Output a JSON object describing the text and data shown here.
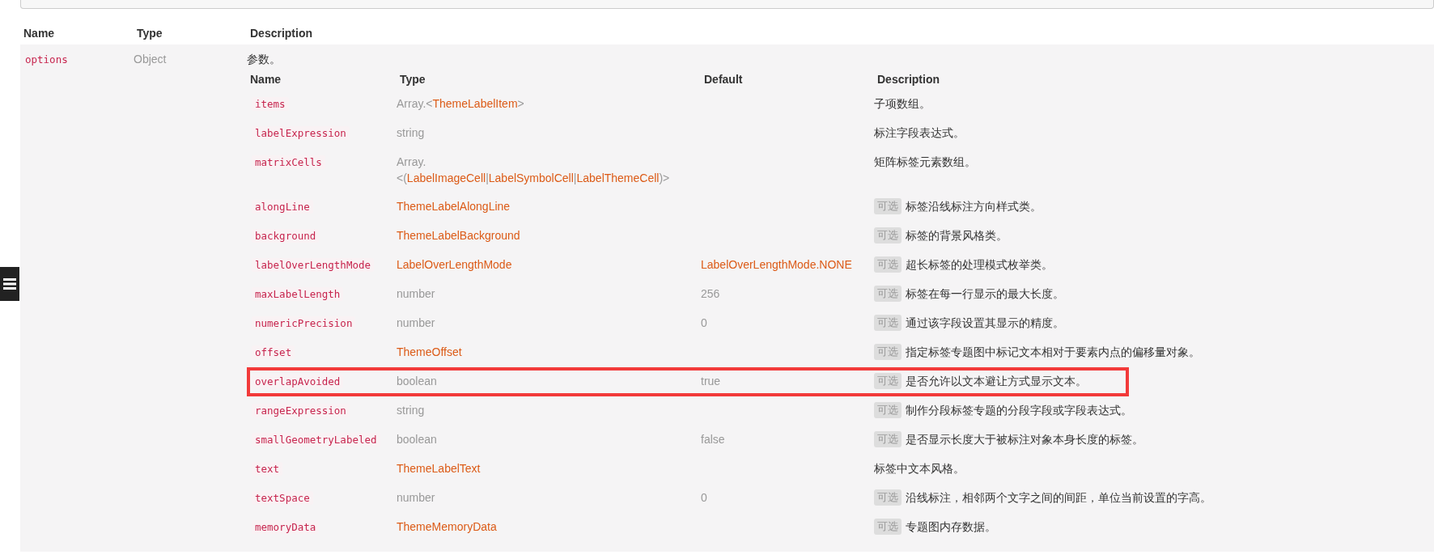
{
  "outer_table": {
    "columns": [
      "Name",
      "Type",
      "Description"
    ],
    "rows": [
      {
        "name": "options",
        "type": "Object",
        "description": "参数。",
        "sub_table": {
          "columns": [
            "Name",
            "Type",
            "Default",
            "Description"
          ],
          "rows": [
            {
              "name": "items",
              "type": [
                [
                  {
                    "kind": "plain",
                    "text": "Array.<"
                  },
                  {
                    "kind": "link",
                    "text": "ThemeLabelItem"
                  },
                  {
                    "kind": "plain",
                    "text": ">"
                  }
                ]
              ],
              "description": "子项数组。",
              "optional": false,
              "highlighted": false
            },
            {
              "name": "labelExpression",
              "type": [
                [
                  {
                    "kind": "plain",
                    "text": "string"
                  }
                ]
              ],
              "description": "标注字段表达式。",
              "optional": false,
              "highlighted": false
            },
            {
              "name": "matrixCells",
              "type": [
                [
                  {
                    "kind": "plain",
                    "text": "Array."
                  }
                ],
                [
                  {
                    "kind": "plain",
                    "text": "<("
                  },
                  {
                    "kind": "link",
                    "text": "LabelImageCell"
                  },
                  {
                    "kind": "plain",
                    "text": "|"
                  },
                  {
                    "kind": "link",
                    "text": "LabelSymbolCell"
                  },
                  {
                    "kind": "plain",
                    "text": "|"
                  },
                  {
                    "kind": "link",
                    "text": "LabelThemeCell"
                  },
                  {
                    "kind": "plain",
                    "text": ")>"
                  }
                ]
              ],
              "description": "矩阵标签元素数组。",
              "optional": false,
              "highlighted": false
            },
            {
              "name": "alongLine",
              "type": [
                [
                  {
                    "kind": "link",
                    "text": "ThemeLabelAlongLine"
                  }
                ]
              ],
              "description": "标签沿线标注方向样式类。",
              "optional": true,
              "optional_label": "可选",
              "highlighted": false
            },
            {
              "name": "background",
              "type": [
                [
                  {
                    "kind": "link",
                    "text": "ThemeLabelBackground"
                  }
                ]
              ],
              "description": "标签的背景风格类。",
              "optional": true,
              "optional_label": "可选",
              "highlighted": false
            },
            {
              "name": "labelOverLengthMode",
              "type": [
                [
                  {
                    "kind": "link",
                    "text": "LabelOverLengthMode"
                  }
                ]
              ],
              "default": {
                "kind": "link",
                "text": "LabelOverLengthMode.NONE"
              },
              "description": "超长标签的处理模式枚举类。",
              "optional": true,
              "optional_label": "可选",
              "highlighted": false
            },
            {
              "name": "maxLabelLength",
              "type": [
                [
                  {
                    "kind": "plain",
                    "text": "number"
                  }
                ]
              ],
              "default": {
                "kind": "plain",
                "text": "256"
              },
              "description": "标签在每一行显示的最大长度。",
              "optional": true,
              "optional_label": "可选",
              "highlighted": false
            },
            {
              "name": "numericPrecision",
              "type": [
                [
                  {
                    "kind": "plain",
                    "text": "number"
                  }
                ]
              ],
              "default": {
                "kind": "plain",
                "text": "0"
              },
              "description": "通过该字段设置其显示的精度。",
              "optional": true,
              "optional_label": "可选",
              "highlighted": false
            },
            {
              "name": "offset",
              "type": [
                [
                  {
                    "kind": "link",
                    "text": "ThemeOffset"
                  }
                ]
              ],
              "description": "指定标签专题图中标记文本相对于要素内点的偏移量对象。",
              "optional": true,
              "optional_label": "可选",
              "highlighted": false
            },
            {
              "name": "overlapAvoided",
              "type": [
                [
                  {
                    "kind": "plain",
                    "text": "boolean"
                  }
                ]
              ],
              "default": {
                "kind": "plain",
                "text": "true"
              },
              "description": "是否允许以文本避让方式显示文本。",
              "optional": true,
              "optional_label": "可选",
              "highlighted": true
            },
            {
              "name": "rangeExpression",
              "type": [
                [
                  {
                    "kind": "plain",
                    "text": "string"
                  }
                ]
              ],
              "description": "制作分段标签专题的分段字段或字段表达式。",
              "optional": true,
              "optional_label": "可选",
              "highlighted": false
            },
            {
              "name": "smallGeometryLabeled",
              "type": [
                [
                  {
                    "kind": "plain",
                    "text": "boolean"
                  }
                ]
              ],
              "default": {
                "kind": "plain",
                "text": "false"
              },
              "description": "是否显示长度大于被标注对象本身长度的标签。",
              "optional": true,
              "optional_label": "可选",
              "highlighted": false
            },
            {
              "name": "text",
              "type": [
                [
                  {
                    "kind": "link",
                    "text": "ThemeLabelText"
                  }
                ]
              ],
              "description": "标签中文本风格。",
              "optional": false,
              "highlighted": false
            },
            {
              "name": "textSpace",
              "type": [
                [
                  {
                    "kind": "plain",
                    "text": "number"
                  }
                ]
              ],
              "default": {
                "kind": "plain",
                "text": "0"
              },
              "description": "沿线标注，相邻两个文字之间的间距，单位当前设置的字高。",
              "optional": true,
              "optional_label": "可选",
              "highlighted": false
            },
            {
              "name": "memoryData",
              "type": [
                [
                  {
                    "kind": "link",
                    "text": "ThemeMemoryData"
                  }
                ]
              ],
              "description": "专题图内存数据。",
              "optional": true,
              "optional_label": "可选",
              "highlighted": false
            }
          ]
        }
      }
    ]
  }
}
